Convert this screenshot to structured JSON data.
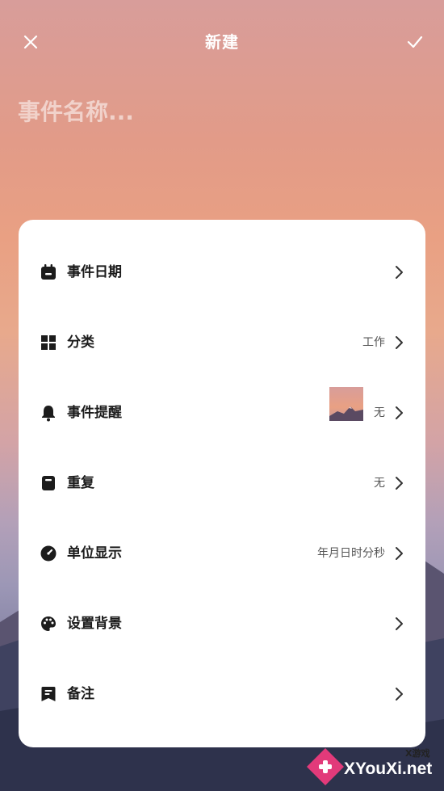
{
  "header": {
    "title": "新建",
    "close_icon": "close-icon",
    "confirm_icon": "check-icon"
  },
  "event_name": {
    "placeholder": "事件名称...",
    "value": ""
  },
  "settings": {
    "items": [
      {
        "id": "date",
        "label": "事件日期",
        "value": "",
        "icon": "calendar-icon"
      },
      {
        "id": "category",
        "label": "分类",
        "value": "工作",
        "icon": "grid-icon"
      },
      {
        "id": "reminder",
        "label": "事件提醒",
        "value": "无",
        "icon": "bell-icon"
      },
      {
        "id": "repeat",
        "label": "重复",
        "value": "无",
        "icon": "note-icon"
      },
      {
        "id": "unit",
        "label": "单位显示",
        "value": "年月日时分秒",
        "icon": "clock-icon"
      },
      {
        "id": "background",
        "label": "设置背景",
        "value": "",
        "icon": "palette-icon"
      },
      {
        "id": "notes",
        "label": "备注",
        "value": "",
        "icon": "bookmark-note-icon"
      }
    ]
  },
  "colors": {
    "card": "#ffffff",
    "text_primary": "#1c1c1c",
    "text_secondary": "#555555",
    "sky_top": "#d89d9a",
    "sky_mid": "#e9a083"
  },
  "watermark": {
    "site": "XYouXi.net",
    "tag": "X游戏"
  }
}
